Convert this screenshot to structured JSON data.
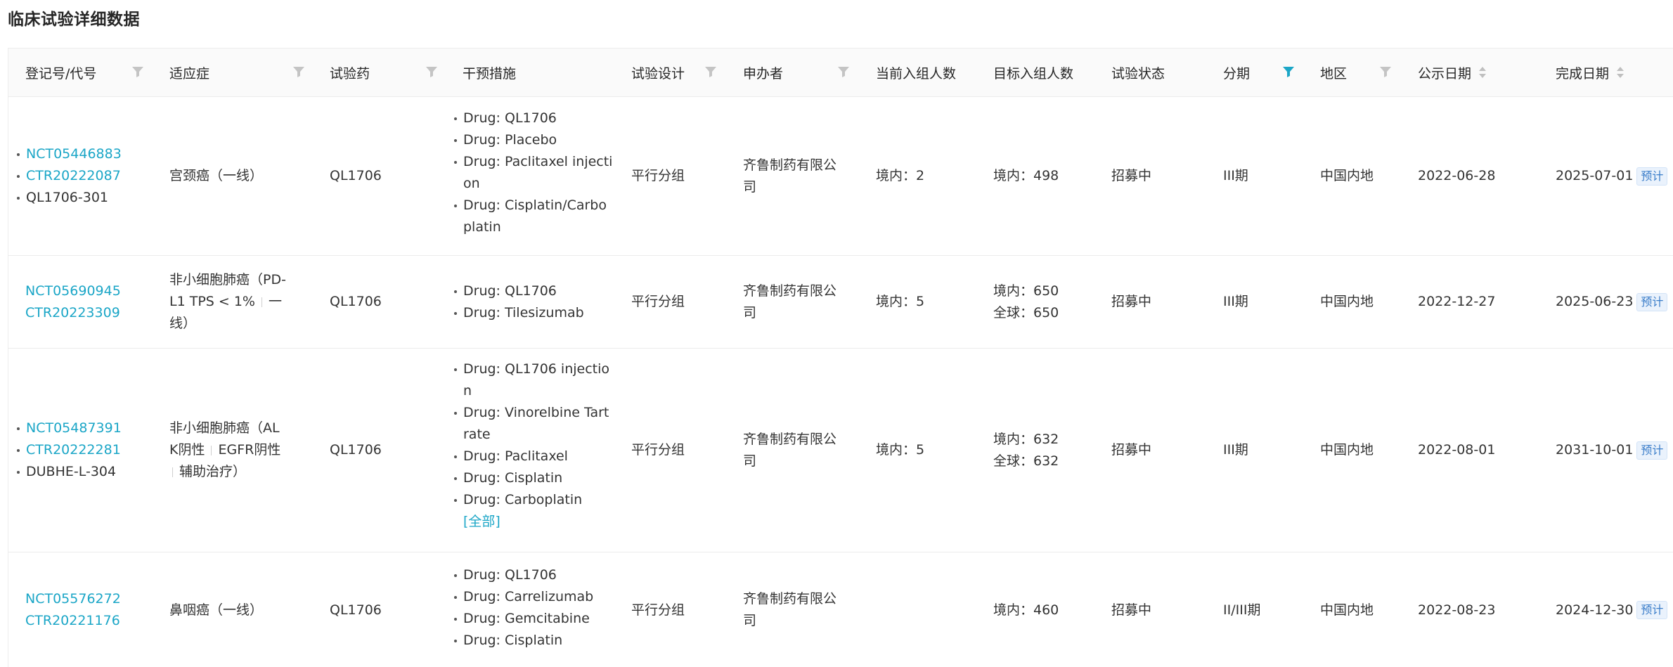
{
  "page": {
    "title": "临床试验详细数据"
  },
  "columns": {
    "reg_no": "登记号/代号",
    "indication": "适应症",
    "drug": "试验药",
    "intervention": "干预措施",
    "design": "试验设计",
    "sponsor": "申办者",
    "current_enroll": "当前入组人数",
    "target_enroll": "目标入组人数",
    "status": "试验状态",
    "phase": "分期",
    "region": "地区",
    "publish_date": "公示日期",
    "completion_date": "完成日期"
  },
  "colors": {
    "link": "#1ba6c7",
    "active_filter": "#1ba6c7",
    "inactive_filter": "#c4c4c4"
  },
  "rows": [
    {
      "ids": [
        {
          "text": "NCT05446883",
          "link": true,
          "bullet": true
        },
        {
          "text": "CTR20222087",
          "link": true,
          "bullet": false
        },
        {
          "text": "QL1706-301",
          "link": false,
          "bullet": true
        }
      ],
      "indication": [
        "宫颈癌（一线）"
      ],
      "drug": "QL1706",
      "interventions": [
        "Drug: QL1706",
        "Drug: Placebo",
        "Drug: Paclitaxel injecti",
        "on",
        "Drug: Cisplatin/Carbo",
        "platin"
      ],
      "design": "平行分组",
      "sponsor": [
        "齐鲁制药有限公",
        "司"
      ],
      "current_enroll": [
        "境内：2"
      ],
      "target_enroll": [
        "境内：498"
      ],
      "status": "招募中",
      "phase": "III期",
      "region": "中国内地",
      "publish_date": "2022-06-28",
      "completion_date": "2025-07-01",
      "badge": "预计"
    },
    {
      "ids": [
        {
          "text": "NCT05690945",
          "link": true,
          "bullet": false
        },
        {
          "text": "CTR20223309",
          "link": true,
          "bullet": false
        }
      ],
      "indication": [
        "非小细胞肺癌（PD-",
        "L1 TPS < 1%",
        "一",
        "线）"
      ],
      "drug": "QL1706",
      "interventions": [
        "Drug: QL1706",
        "Drug: Tilesizumab"
      ],
      "design": "平行分组",
      "sponsor": [
        "齐鲁制药有限公",
        "司"
      ],
      "current_enroll": [
        "境内：5"
      ],
      "target_enroll": [
        "境内：650",
        "全球：650"
      ],
      "status": "招募中",
      "phase": "III期",
      "region": "中国内地",
      "publish_date": "2022-12-27",
      "completion_date": "2025-06-23",
      "badge": "预计"
    },
    {
      "ids": [
        {
          "text": "NCT05487391",
          "link": true,
          "bullet": true
        },
        {
          "text": "CTR20222281",
          "link": true,
          "bullet": false
        },
        {
          "text": "DUBHE-L-304",
          "link": false,
          "bullet": true
        }
      ],
      "indication": [
        "非小细胞肺癌（AL",
        "K阴性",
        "EGFR阴性",
        "辅助治疗）"
      ],
      "drug": "QL1706",
      "interventions": [
        "Drug: QL1706 injectio",
        "n",
        "Drug: Vinorelbine Tart",
        "rate",
        "Drug: Paclitaxel",
        "Drug: Cisplatin",
        "Drug: Carboplatin"
      ],
      "more_label": "[全部]",
      "design": "平行分组",
      "sponsor": [
        "齐鲁制药有限公",
        "司"
      ],
      "current_enroll": [
        "境内：5"
      ],
      "target_enroll": [
        "境内：632",
        "全球：632"
      ],
      "status": "招募中",
      "phase": "III期",
      "region": "中国内地",
      "publish_date": "2022-08-01",
      "completion_date": "2031-10-01",
      "badge": "预计"
    },
    {
      "ids": [
        {
          "text": "NCT05576272",
          "link": true,
          "bullet": false
        },
        {
          "text": "CTR20221176",
          "link": true,
          "bullet": false
        }
      ],
      "indication": [
        "鼻咽癌（一线）"
      ],
      "drug": "QL1706",
      "interventions": [
        "Drug: QL1706",
        "Drug: Carrelizumab",
        "Drug: Gemcitabine",
        "Drug: Cisplatin"
      ],
      "design": "平行分组",
      "sponsor": [
        "齐鲁制药有限公",
        "司"
      ],
      "current_enroll": [],
      "target_enroll": [
        "境内：460"
      ],
      "status": "招募中",
      "phase": "II/III期",
      "region": "中国内地",
      "publish_date": "2022-08-23",
      "completion_date": "2024-12-30",
      "badge": "预计"
    }
  ]
}
